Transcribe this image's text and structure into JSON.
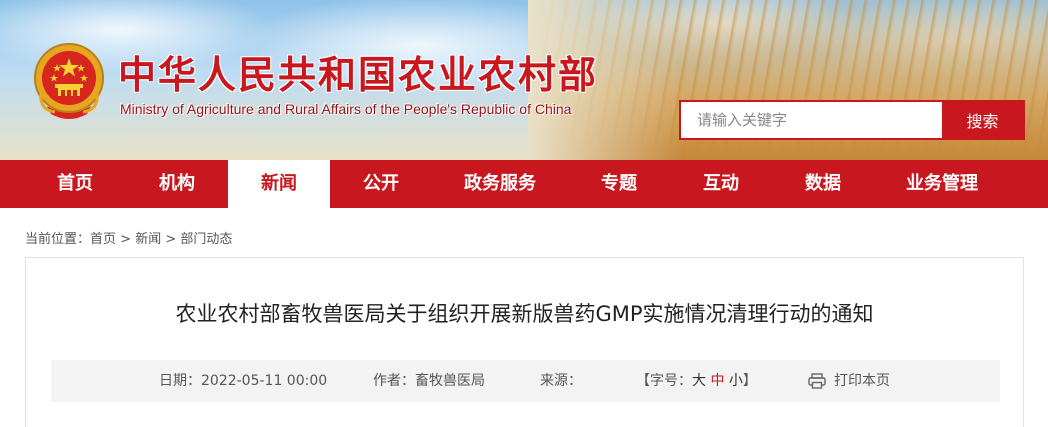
{
  "header": {
    "title": "中华人民共和国农业农村部",
    "subtitle": "Ministry of Agriculture and Rural Affairs of the People's Republic of China",
    "emblem_icon": "national-emblem-icon"
  },
  "search": {
    "placeholder": "请输入关键字",
    "button_label": "搜索"
  },
  "nav": {
    "items": [
      {
        "label": "首页"
      },
      {
        "label": "机构"
      },
      {
        "label": "新闻"
      },
      {
        "label": "公开"
      },
      {
        "label": "政务服务"
      },
      {
        "label": "专题"
      },
      {
        "label": "互动"
      },
      {
        "label": "数据"
      },
      {
        "label": "业务管理"
      }
    ],
    "active_index": 2
  },
  "breadcrumb": {
    "prefix": "当前位置：",
    "items": [
      "首页",
      "新闻",
      "部门动态"
    ],
    "separator": ">"
  },
  "article": {
    "title": "农业农村部畜牧兽医局关于组织开展新版兽药GMP实施情况清理行动的通知",
    "date_label": "日期：",
    "date": "2022-05-11 00:00",
    "author_label": "作者：",
    "author": "畜牧兽医局",
    "source_label": "来源：",
    "source": "",
    "font_size": {
      "open": "【字号：",
      "big": "大",
      "mid": "中",
      "small": "小",
      "close": "】"
    },
    "print_label": "打印本页",
    "print_icon": "printer-icon"
  },
  "colors": {
    "brand_red": "#c8171e",
    "meta_bg": "#f3f3f3"
  }
}
